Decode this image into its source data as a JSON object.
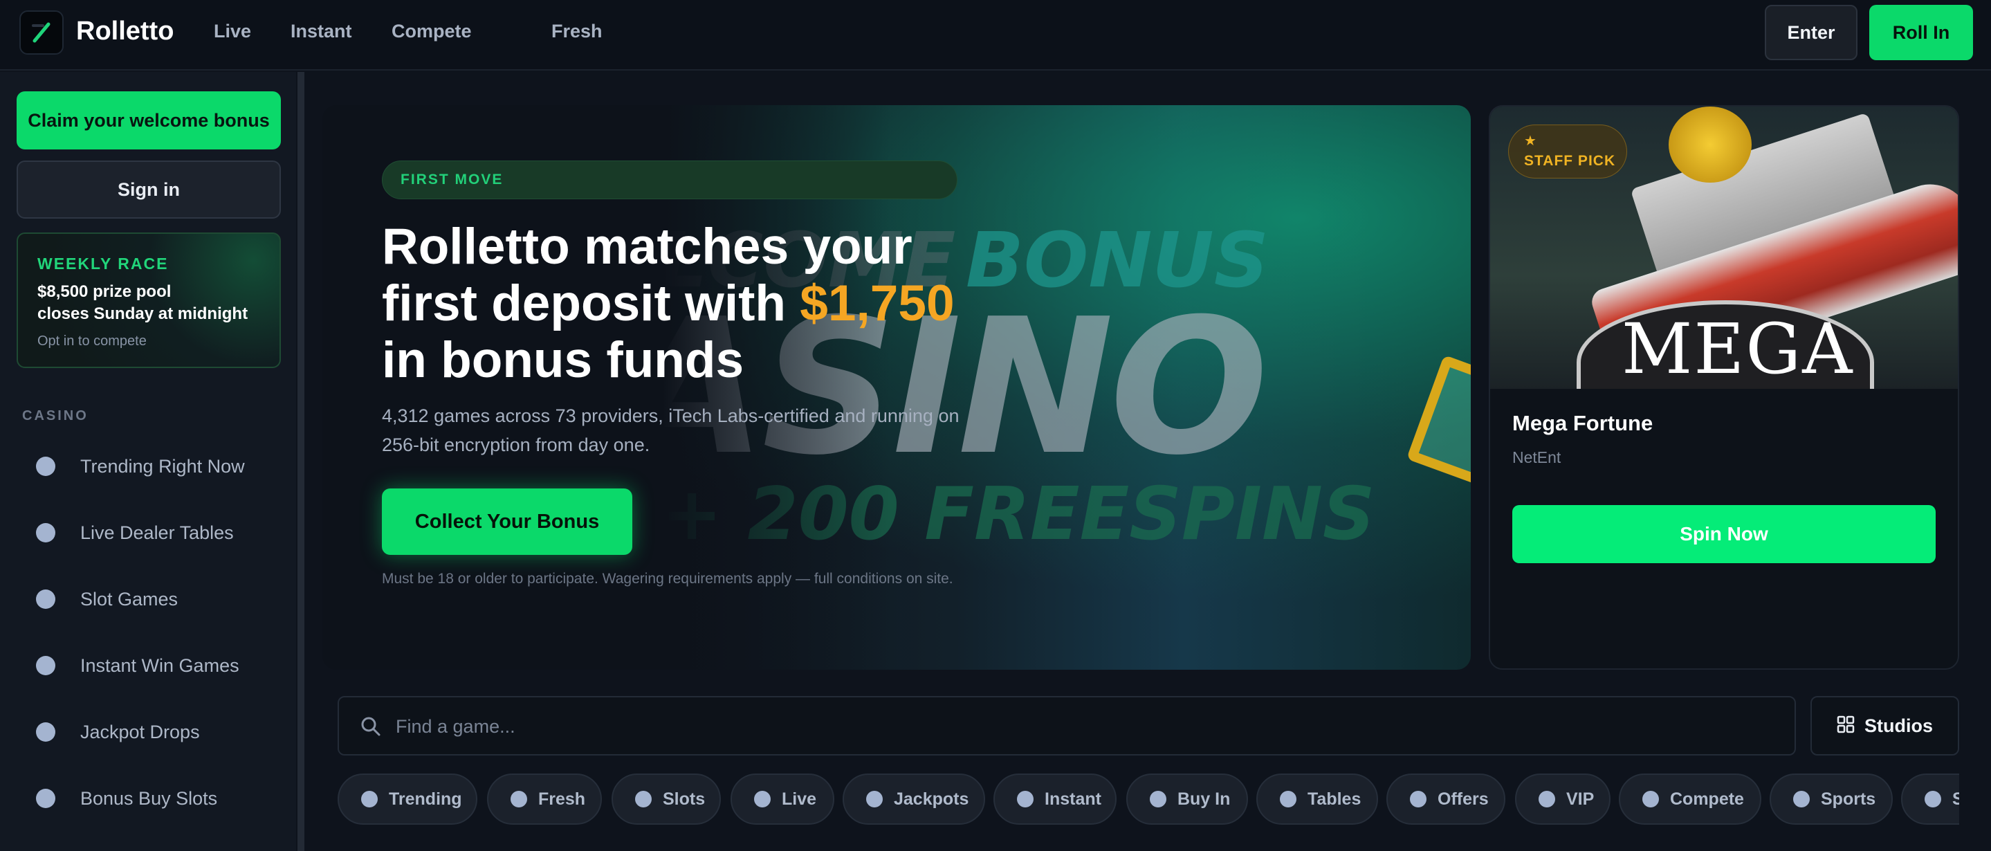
{
  "header": {
    "brand": "Rolletto",
    "nav": [
      "Live",
      "Instant",
      "Compete",
      "Fresh"
    ],
    "enter_label": "Enter",
    "rollin_label": "Roll In"
  },
  "sidebar": {
    "claim_label": "Claim your welcome bonus",
    "signin_label": "Sign in",
    "race": {
      "title": "WEEKLY RACE",
      "line1": "$8,500 prize pool",
      "line2": "closes Sunday at midnight",
      "note": "Opt in to compete"
    },
    "section_label": "CASINO",
    "items": [
      {
        "label": "Trending Right Now"
      },
      {
        "label": "Live Dealer Tables"
      },
      {
        "label": "Slot Games"
      },
      {
        "label": "Instant Win Games"
      },
      {
        "label": "Jackpot Drops"
      },
      {
        "label": "Bonus Buy Slots"
      }
    ]
  },
  "hero": {
    "badge": "FIRST MOVE",
    "title_part1": "Rolletto matches your first deposit with ",
    "title_amount": "$1,750",
    "title_part2": " in bonus funds",
    "subtitle": "4,312 games across 73 providers, iTech Labs-certified and running on 256-bit encryption from day one.",
    "cta": "Collect Your Bonus",
    "terms": "Must be 18 or older to participate. Wagering requirements apply — full conditions on site.",
    "banner_text": {
      "welcome": "WELCOME",
      "bonus": "BONUS",
      "casino": "CASINO",
      "freespins": "+ 200 FREESPINS"
    }
  },
  "featured": {
    "tag": "STAFF PICK",
    "star": "★",
    "art_text": "MEGA",
    "name": "Mega Fortune",
    "provider": "NetEnt",
    "cta": "Spin Now"
  },
  "search": {
    "placeholder": "Find a game...",
    "value": "",
    "studios_label": "Studios"
  },
  "categories": [
    "Trending",
    "Fresh",
    "Slots",
    "Live",
    "Jackpots",
    "Instant",
    "Buy In",
    "Tables",
    "Offers",
    "VIP",
    "Compete",
    "Sports",
    "Sc"
  ],
  "colors": {
    "accent_green": "#0bd96a",
    "gold": "#f5a623",
    "background": "#0e131c"
  }
}
